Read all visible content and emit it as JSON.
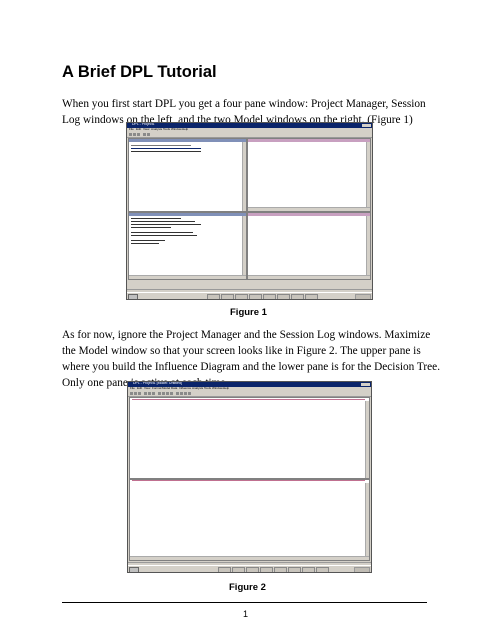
{
  "document": {
    "title": "A Brief DPL Tutorial",
    "paragraph1": "When you first start DPL you get a four pane window: Project Manager, Session Log windows on the left, and the two Model windows on the right. (Figure 1)",
    "figure1_caption": "Figure 1",
    "paragraph2": "As for now, ignore the Project Manager and the Session Log windows. Maximize the Model window so that your screen looks like in Figure 2. The upper pane is where you build the Influence Diagram and the lower pane is for the Decision Tree. Only one pane is active at each time.",
    "figure2_caption": "Figure 2",
    "page_number": "1"
  },
  "figure1": {
    "window_title": "DPL - Project1",
    "menu": [
      "File",
      "Edit",
      "View",
      "Analysis",
      "Tools",
      "Window",
      "Help"
    ]
  },
  "figure2": {
    "window_title": "DPL - Project1 [Model: Untitled]",
    "menu": [
      "File",
      "Edit",
      "View",
      "Format",
      "Model",
      "Data",
      "Influence",
      "Analysis",
      "Tools",
      "Window",
      "Help"
    ]
  }
}
